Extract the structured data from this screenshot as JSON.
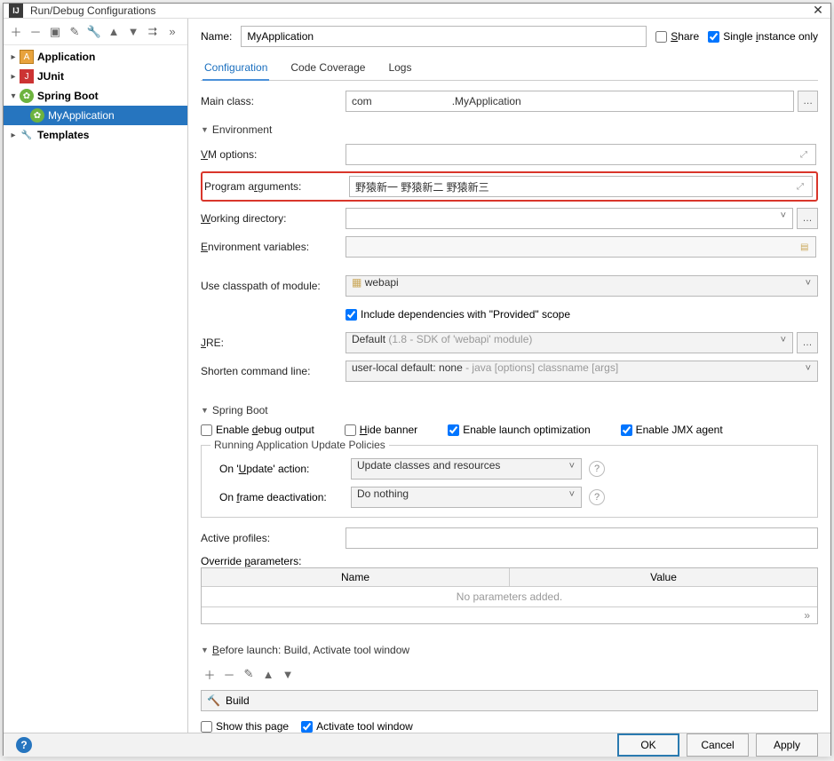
{
  "window": {
    "title": "Run/Debug Configurations"
  },
  "toolbar_icons": [
    "＋",
    "－",
    "▣",
    "✎",
    "🔧",
    "▲",
    "▼",
    "⮆",
    "»"
  ],
  "tree": {
    "items": [
      {
        "label": "Application",
        "icon": "app",
        "bold": true,
        "expandable": true
      },
      {
        "label": "JUnit",
        "icon": "junit",
        "bold": true,
        "expandable": true
      },
      {
        "label": "Spring Boot",
        "icon": "sb",
        "bold": true,
        "expanded": true
      },
      {
        "label": "MyApplication",
        "icon": "sb",
        "child": true,
        "selected": true
      },
      {
        "label": "Templates",
        "icon": "tpl",
        "bold": true,
        "expandable": true
      }
    ]
  },
  "header": {
    "name_label": "Name:",
    "name_value": "MyApplication",
    "share_label": "Share",
    "single_instance_label": "Single instance only",
    "share_checked": false,
    "single_checked": true
  },
  "tabs": [
    {
      "label": "Configuration",
      "active": true
    },
    {
      "label": "Code Coverage"
    },
    {
      "label": "Logs"
    }
  ],
  "form": {
    "main_class_label": "Main class:",
    "main_class_value": "com                           .MyApplication",
    "env_section": "Environment",
    "vm_label": "VM options:",
    "vm_value": "",
    "args_label": "Program arguments:",
    "args_value": "野猿新一 野猿新二 野猿新三",
    "wd_label": "Working directory:",
    "wd_value": "",
    "envvars_label": "Environment variables:",
    "envvars_value": "",
    "classpath_label": "Use classpath of module:",
    "classpath_value": "webapi",
    "include_dep_label": "Include dependencies with \"Provided\" scope",
    "include_dep_checked": true,
    "jre_label": "JRE:",
    "jre_value": "Default",
    "jre_hint": "(1.8 - SDK of 'webapi' module)",
    "shorten_label": "Shorten command line:",
    "shorten_value": "user-local default: none",
    "shorten_hint": " - java [options] classname [args]"
  },
  "sb": {
    "section": "Spring Boot",
    "debug_label": "Enable debug output",
    "debug": false,
    "hide_label": "Hide banner",
    "hide": false,
    "launch_label": "Enable launch optimization",
    "launch": true,
    "jmx_label": "Enable JMX agent",
    "jmx": true,
    "policies_title": "Running Application Update Policies",
    "update_label": "On 'Update' action:",
    "update_value": "Update classes and resources",
    "frame_label": "On frame deactivation:",
    "frame_value": "Do nothing",
    "profiles_label": "Active profiles:",
    "profiles_value": "",
    "override_label": "Override parameters:",
    "th_name": "Name",
    "th_value": "Value",
    "empty": "No parameters added.",
    "more": "»"
  },
  "before": {
    "section": "Before launch: Build, Activate tool window",
    "icons": [
      "＋",
      "－",
      "✎",
      "▲",
      "▼"
    ],
    "build_label": "Build",
    "show_label": "Show this page",
    "show": false,
    "activate_label": "Activate tool window",
    "activate": true
  },
  "footer": {
    "ok": "OK",
    "cancel": "Cancel",
    "apply": "Apply"
  }
}
